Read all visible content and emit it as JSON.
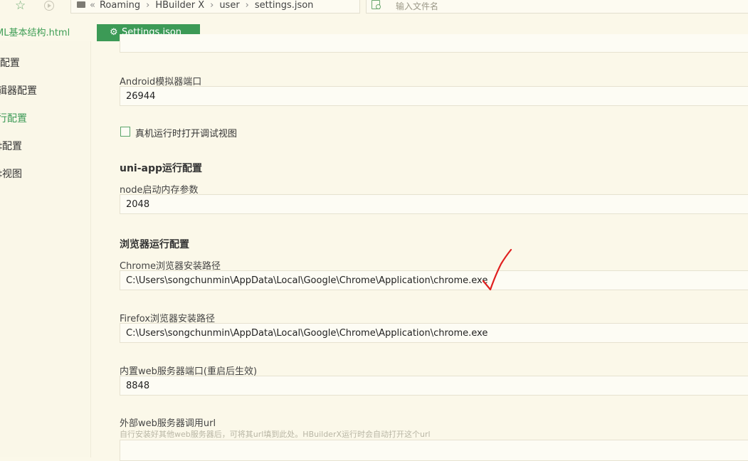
{
  "toolbar": {
    "breadcrumbs": [
      "Roaming",
      "HBuilder X",
      "user",
      "settings.json"
    ],
    "search_placeholder": "输入文件名"
  },
  "tabs": {
    "inactive": "ML基本结构.html",
    "active": "Settings.json"
  },
  "sidebar": {
    "items": [
      {
        "label": "l配置",
        "active": false
      },
      {
        "label": "辑器配置",
        "active": false
      },
      {
        "label": "行配置",
        "active": true
      },
      {
        "label": "‡配置",
        "active": false
      },
      {
        "label": "‡视图",
        "active": false
      }
    ]
  },
  "settings": {
    "android_port_label": "Android模拟器端口",
    "android_port_value": "26944",
    "debug_view_label": "真机运行时打开调试视图",
    "uniapp_section": "uni-app运行配置",
    "node_mem_label": "node启动内存参数",
    "node_mem_value": "2048",
    "browser_section": "浏览器运行配置",
    "chrome_label": "Chrome浏览器安装路径",
    "chrome_value": "C:\\Users\\songchunmin\\AppData\\Local\\Google\\Chrome\\Application\\chrome.exe",
    "firefox_label": "Firefox浏览器安装路径",
    "firefox_value": "C:\\Users\\songchunmin\\AppData\\Local\\Google\\Chrome\\Application\\chrome.exe",
    "web_port_label": "内置web服务器端口(重启后生效)",
    "web_port_value": "8848",
    "ext_url_label": "外部web服务器调用url",
    "ext_url_hint": "自行安装好其他web服务器后，可将其url填到此处。HBuilderX运行时会自动打开这个url",
    "ext_url_value": ""
  },
  "colors": {
    "accent": "#3c9a56",
    "background": "#fbf8e9",
    "annotation": "#e02020"
  }
}
